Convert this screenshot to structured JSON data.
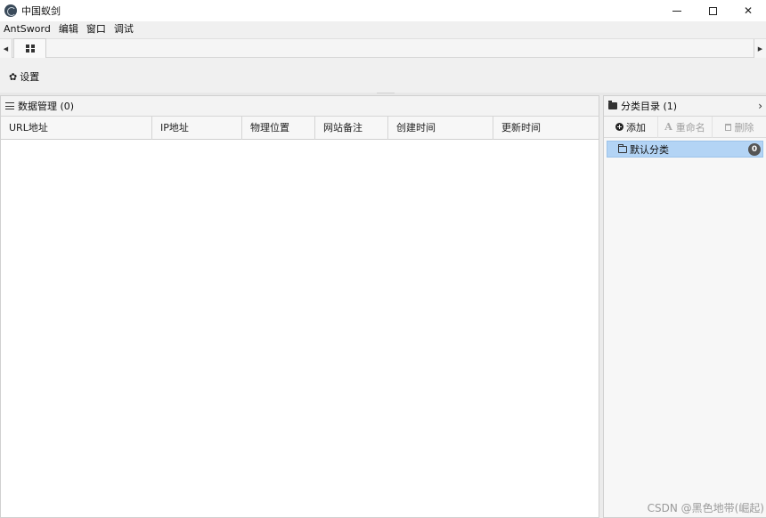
{
  "window": {
    "title": "中国蚁剑",
    "minimize_glyph": "—",
    "close_glyph": "✕"
  },
  "menu": {
    "items": [
      {
        "label": "AntSword"
      },
      {
        "label": "编辑"
      },
      {
        "label": "窗口"
      },
      {
        "label": "调试"
      }
    ]
  },
  "tabstrip": {
    "scroll_left_glyph": "◀",
    "scroll_right_glyph": "▶",
    "home_tab_icon": "grid-icon"
  },
  "toolbar": {
    "settings_label": "设置",
    "settings_icon_glyph": "✿"
  },
  "data_panel": {
    "title": "数据管理 (0)",
    "columns": [
      {
        "label": "URL地址"
      },
      {
        "label": "IP地址"
      },
      {
        "label": "物理位置"
      },
      {
        "label": "网站备注"
      },
      {
        "label": "创建时间"
      },
      {
        "label": "更新时间"
      }
    ],
    "rows": []
  },
  "category_panel": {
    "title": "分类目录 (1)",
    "chevron_glyph": "›",
    "add_label": "添加",
    "rename_label": "重命名",
    "delete_label": "删除",
    "items": [
      {
        "label": "默认分类",
        "count": "0",
        "selected": true
      }
    ]
  },
  "watermark": "CSDN @黑色地带(崛起)",
  "colors": {
    "selected_row": "#b3d4f5",
    "badge": "#555555",
    "disabled_text": "#a0a0a0"
  }
}
